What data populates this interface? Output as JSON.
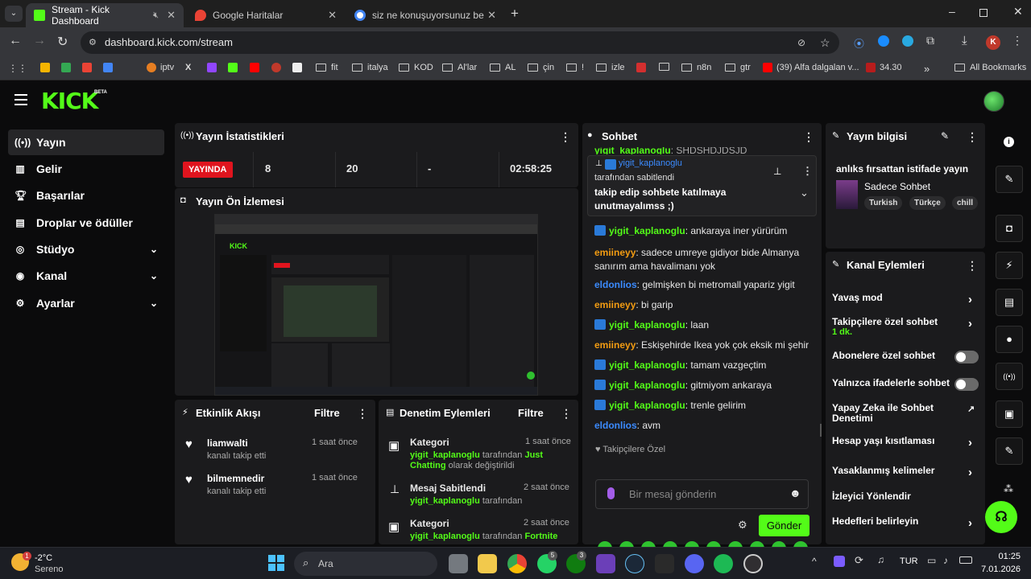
{
  "browser": {
    "tabs": [
      {
        "title": "Stream - Kick Dashboard",
        "active": true
      },
      {
        "title": "Google Haritalar",
        "active": false
      },
      {
        "title": "siz ne konuşuyorsunuz be anası",
        "active": false
      }
    ],
    "url": "dashboard.kick.com/stream",
    "profile_initial": "K",
    "bookmarks": [
      "iptv",
      "fit",
      "italya",
      "KOD",
      "Al'lar",
      "AL",
      "çin",
      "!",
      "izle",
      "n8n",
      "gtr",
      "(39) Alfa dalgalan v...",
      "34.30"
    ],
    "all_bookmarks": "All Bookmarks",
    "more": "»"
  },
  "kick": {
    "logo": "KICK",
    "beta": "BETA",
    "sidebar": [
      {
        "label": "Yayın",
        "icon": "broadcast-icon",
        "active": true,
        "chevron": false
      },
      {
        "label": "Gelir",
        "icon": "chart-icon",
        "chevron": false
      },
      {
        "label": "Başarılar",
        "icon": "trophy-icon",
        "chevron": false
      },
      {
        "label": "Droplar ve ödüller",
        "icon": "gift-icon",
        "chevron": false
      },
      {
        "label": "Stüdyo",
        "icon": "studio-icon",
        "chevron": true
      },
      {
        "label": "Kanal",
        "icon": "user-icon",
        "chevron": true
      },
      {
        "label": "Ayarlar",
        "icon": "gear-icon",
        "chevron": true
      }
    ],
    "stats": {
      "title": "Yayın İstatistikleri",
      "live": "YAYINDA",
      "viewers": "8",
      "followers": "20",
      "subs": "-",
      "duration": "02:58:25"
    },
    "preview": {
      "title": "Yayın Ön İzlemesi"
    },
    "activity": {
      "title": "Etkinlik Akışı",
      "filter": "Filtre",
      "events": [
        {
          "user": "liamwalti",
          "text": "kanalı takip etti",
          "time": "1 saat önce"
        },
        {
          "user": "bilmemnedir",
          "text": "kanalı takip etti",
          "time": "1 saat önce"
        }
      ]
    },
    "moderation": {
      "title": "Denetim Eylemleri",
      "filter": "Filtre",
      "items": [
        {
          "title": "Kategori",
          "time": "1 saat önce",
          "user": "yigit_kaplanoglu",
          "mid": "tarafından",
          "value": "Just Chatting",
          "tail": "olarak değiştirildi"
        },
        {
          "title": "Mesaj Sabitlendi",
          "time": "2 saat önce",
          "user": "yigit_kaplanoglu",
          "mid": "tarafından",
          "value": "",
          "tail": ""
        },
        {
          "title": "Kategori",
          "time": "2 saat önce",
          "user": "yigit_kaplanoglu",
          "mid": "tarafından",
          "value": "Fortnite",
          "tail": ""
        }
      ]
    },
    "chat": {
      "title": "Sohbet",
      "partial_top": "yigit_kaplanoglu: SHDSHDJDSJD",
      "pinned": {
        "user": "yigit_kaplanoglu",
        "by": "tarafından sabitlendi",
        "text": "takip edip sohbete katılmaya unutmayalımss ;)"
      },
      "messages": [
        {
          "user": "yigit_kaplanoglu",
          "color": "green",
          "badge": true,
          "text": "ankaraya iner yürürüm"
        },
        {
          "user": "emiineyy",
          "color": "orange",
          "badge": false,
          "text": "sadece umreye gidiyor bide Almanya sanırım ama havalimanı yok"
        },
        {
          "user": "eldonlios",
          "color": "blue",
          "badge": false,
          "text": "gelmişken bi metromall yapariz yigit"
        },
        {
          "user": "emiineyy",
          "color": "orange",
          "badge": false,
          "text": "bi garip"
        },
        {
          "user": "yigit_kaplanoglu",
          "color": "green",
          "badge": true,
          "text": "laan"
        },
        {
          "user": "emiineyy",
          "color": "orange",
          "badge": false,
          "text": "Eskişehirde Ikea yok çok eksik mi şehir"
        },
        {
          "user": "yigit_kaplanoglu",
          "color": "green",
          "badge": true,
          "text": "tamam vazgeçtim"
        },
        {
          "user": "yigit_kaplanoglu",
          "color": "green",
          "badge": true,
          "text": "gitmiyom ankaraya"
        },
        {
          "user": "yigit_kaplanoglu",
          "color": "green",
          "badge": true,
          "text": "trenle gelirim"
        },
        {
          "user": "eldonlios",
          "color": "blue",
          "badge": false,
          "text": "avm"
        }
      ],
      "followers_only": "Takipçilere Özel",
      "placeholder": "Bir mesaj gönderin",
      "send": "Gönder"
    },
    "stream_info": {
      "title": "Yayın bilgisi",
      "stream_title": "anlıks fırsattan istifade yayın",
      "category": "Sadece Sohbet",
      "tags": [
        "Turkish",
        "Türkçe",
        "chill"
      ]
    },
    "channel_actions": {
      "title": "Kanal Eylemleri",
      "items": [
        {
          "label": "Yavaş mod",
          "control": "chevron"
        },
        {
          "label": "Takipçilere özel sohbet",
          "sub": "1 dk.",
          "control": "chevron"
        },
        {
          "label": "Abonelere özel sohbet",
          "control": "toggle"
        },
        {
          "label": "Yalnızca ifadelerle sohbet",
          "control": "toggle"
        },
        {
          "label": "Yapay Zeka ile Sohbet Denetimi",
          "control": "external"
        },
        {
          "label": "Hesap yaşı kısıtlaması",
          "control": "chevron"
        },
        {
          "label": "Yasaklanmış kelimeler",
          "control": "chevron"
        },
        {
          "label": "İzleyici Yönlendir",
          "control": "none"
        },
        {
          "label": "Hedefleri belirleyin",
          "control": "chevron"
        }
      ]
    }
  },
  "taskbar": {
    "weather_temp": "-2°C",
    "weather_desc": "Sereno",
    "weather_badge": "1",
    "search": "Ara",
    "lang": "TUR",
    "time": "01:25",
    "date": "7.01.2026",
    "badges": [
      "5",
      "3"
    ]
  },
  "colors": {
    "kick_green": "#53fc18",
    "live_red": "#e0141e",
    "bg": "#0b0b0c",
    "panel": "#1b1b1d"
  }
}
